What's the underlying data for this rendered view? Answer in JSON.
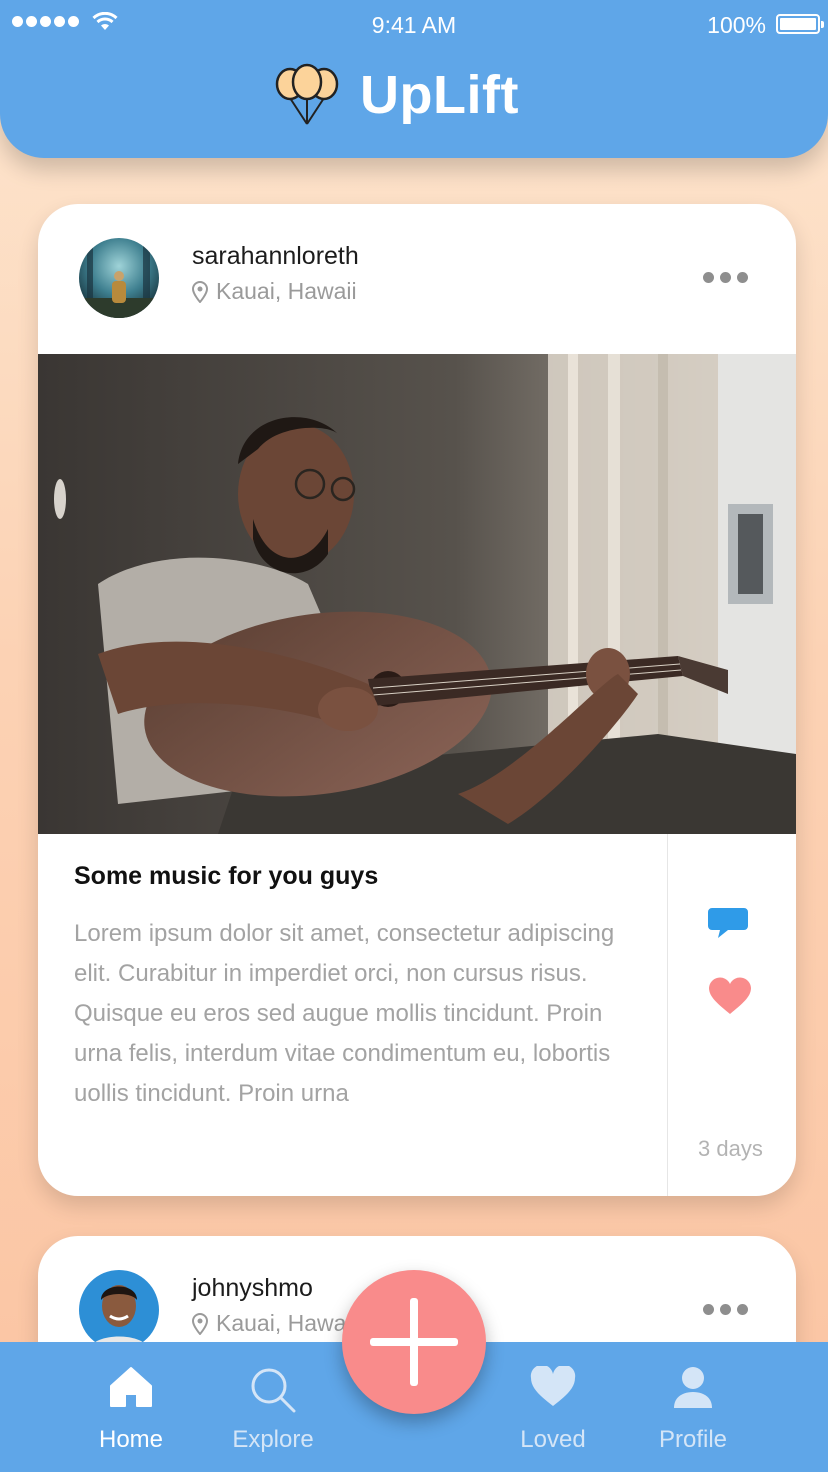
{
  "status_bar": {
    "time": "9:41 AM",
    "battery": "100%"
  },
  "header": {
    "app_name": "UpLift",
    "logo_icon": "balloons-icon"
  },
  "posts": [
    {
      "username": "sarahannloreth",
      "location": "Kauai, Hawaii",
      "title": "Some music for you guys",
      "body": "Lorem ipsum dolor sit amet, consectetur adipiscing elit. Curabitur in imperdiet orci, non cursus risus. Quisque eu eros sed augue mollis tincidunt. Proin urna felis, interdum vitae condimentum eu, lobortis uollis tincidunt. Proin urna",
      "time_ago": "3 days",
      "image": "man-playing-guitar-photo"
    },
    {
      "username": "johnyshmo",
      "location": "Kauai, Hawaii"
    }
  ],
  "tabbar": {
    "tabs": [
      {
        "label": "Home",
        "icon": "home-icon",
        "active": true
      },
      {
        "label": "Explore",
        "icon": "search-icon"
      },
      {
        "label": "Loved",
        "icon": "heart-icon"
      },
      {
        "label": "Profile",
        "icon": "person-icon"
      }
    ],
    "fab_icon": "plus-icon"
  },
  "colors": {
    "primary": "#5fa6e8",
    "accent": "#f98b8b",
    "comment": "#2f9be8"
  }
}
